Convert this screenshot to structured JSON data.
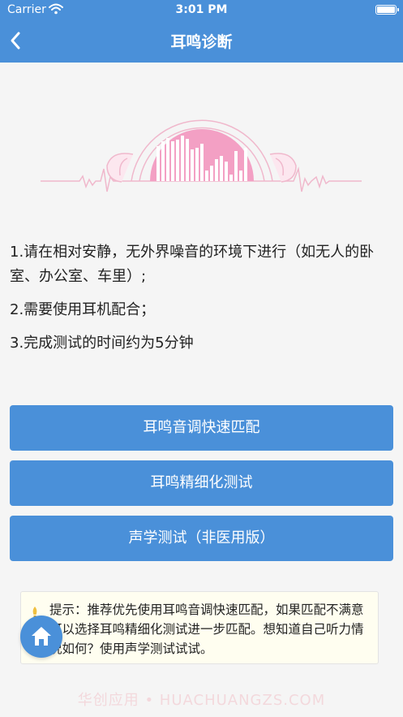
{
  "status_bar": {
    "carrier": "Carrier",
    "time": "3:01 PM",
    "wifi_icon": "wifi-icon",
    "battery_icon": "battery-icon"
  },
  "nav": {
    "title": "耳鸣诊断",
    "back_icon": "chevron-left-icon"
  },
  "hero": {
    "icon": "ear-sound-waveform-illustration",
    "accent_color": "#f3a0c4",
    "line_color": "#f0b8cc"
  },
  "instructions": [
    "1.请在相对安静，无外界噪音的环境下进行（如无人的卧室、办公室、车里）;",
    "2.需要使用耳机配合；",
    "3.完成测试的时间约为5分钟"
  ],
  "buttons": {
    "quick_match": "耳鸣音调快速匹配",
    "fine_test": "耳鸣精细化测试",
    "acoustic_test": "声学测试（非医用版）"
  },
  "tip": {
    "icon": "lightbulb-icon",
    "text": "提示：推荐优先使用耳鸣音调快速匹配，如果匹配不满意可以选择耳鸣精细化测试进一步匹配。想知道自己听力情况如何？使用声学测试试试。"
  },
  "home_button": {
    "icon": "home-icon"
  },
  "watermark": "华创应用 • HUACHUANGZS.COM",
  "colors": {
    "primary": "#4a90d9",
    "background": "#f5f5f5",
    "tip_background": "#fffef0"
  }
}
